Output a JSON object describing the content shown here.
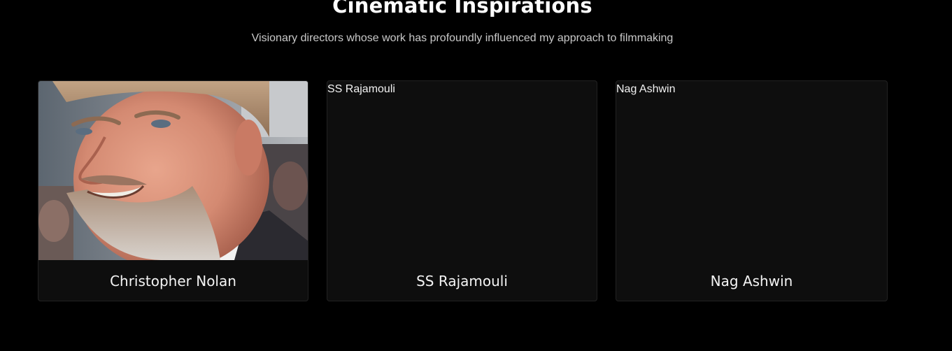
{
  "section": {
    "title": "Cinematic Inspirations",
    "subtitle": "Visionary directors whose work has profoundly influenced my approach to filmmaking"
  },
  "directors": [
    {
      "name": "Christopher Nolan",
      "image_alt": "Christopher Nolan",
      "image_loaded": true
    },
    {
      "name": "SS Rajamouli",
      "image_alt": "SS Rajamouli",
      "image_loaded": false
    },
    {
      "name": "Nag Ashwin",
      "image_alt": "Nag Ashwin",
      "image_loaded": false
    }
  ],
  "colors": {
    "background": "#000000",
    "card_background": "#0e0e0e",
    "card_border": "#222222",
    "subtitle_text": "#c9c9c9"
  }
}
